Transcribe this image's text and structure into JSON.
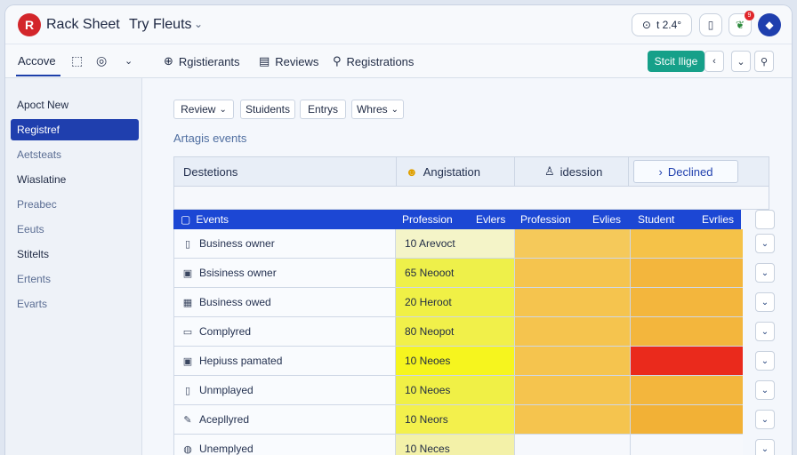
{
  "titlebar": {
    "logo_letter": "R",
    "app_title": "Rack Sheet",
    "app_subtitle": "Try Fleuts",
    "right_pill_text": "t 2.4°",
    "notif_count": "9"
  },
  "toolbar": {
    "active_tab": "Accove",
    "tabs": [
      {
        "icon": "globe-icon",
        "label": "Rgistierants"
      },
      {
        "icon": "document-icon",
        "label": "Reviews"
      },
      {
        "icon": "search-icon",
        "label": "Registrations"
      }
    ],
    "start_button": "Stcit Ilige"
  },
  "sidebar": {
    "items": [
      {
        "label": "Apoct New"
      },
      {
        "label": "Registref"
      },
      {
        "label": "Aetsteats"
      },
      {
        "label": "Wiaslatine"
      },
      {
        "label": "Preabec"
      },
      {
        "label": "Eeuts"
      },
      {
        "label": "Stitelts"
      },
      {
        "label": "Ertents"
      },
      {
        "label": "Evarts"
      }
    ],
    "active_index": 1
  },
  "filters": [
    {
      "label": "Review",
      "has_caret": true
    },
    {
      "label": "Stuidents",
      "has_caret": false
    },
    {
      "label": "Entrys",
      "has_caret": false
    },
    {
      "label": "Whres",
      "has_caret": true
    }
  ],
  "section_label": "Artagis events",
  "header_strip": {
    "col1": "Destetions",
    "col2": "Angistation",
    "col3": "idession",
    "col4": "Declined"
  },
  "grid": {
    "headers": [
      "Events",
      "Profession",
      "Evlers",
      "Profession",
      "Evlies",
      "Student",
      "Evrlies"
    ],
    "rows": [
      {
        "icon": "document-icon",
        "label": "Business owner",
        "value": "10 Arevoct",
        "colors": [
          "#f4f4c8",
          "#f5c95a",
          "#f5c248"
        ]
      },
      {
        "icon": "briefcase-icon",
        "label": "Bsisiness owner",
        "value": "65 Neooot",
        "colors": [
          "#eef04a",
          "#f5c44e",
          "#f3b63d"
        ]
      },
      {
        "icon": "building-icon",
        "label": "Business owed",
        "value": "20 Heroot",
        "colors": [
          "#f0f046",
          "#f5c44e",
          "#f3b63d"
        ]
      },
      {
        "icon": "chat-icon",
        "label": "Complyred",
        "value": "80 Neopot",
        "colors": [
          "#f1f04a",
          "#f5c44e",
          "#f3b63d"
        ]
      },
      {
        "icon": "briefcase-icon",
        "label": "Hepiuss pamated",
        "value": "10 Neoes",
        "colors": [
          "#f6f51e",
          "#f5c44e",
          "#ea2a1c"
        ]
      },
      {
        "icon": "document-icon",
        "label": "Unmplayed",
        "value": "10 Neoes",
        "colors": [
          "#f0f046",
          "#f5c44e",
          "#f3b63d"
        ]
      },
      {
        "icon": "wrench-icon",
        "label": "Acepllyred",
        "value": "10 Neors",
        "colors": [
          "#f3f04c",
          "#f5c44e",
          "#f2b136"
        ]
      },
      {
        "icon": "globe-icon",
        "label": "Unemplyed",
        "value": "10 Neces",
        "colors": [
          "#f3f1a8",
          "#f6f8fc",
          "#f6f8fc"
        ]
      }
    ]
  }
}
